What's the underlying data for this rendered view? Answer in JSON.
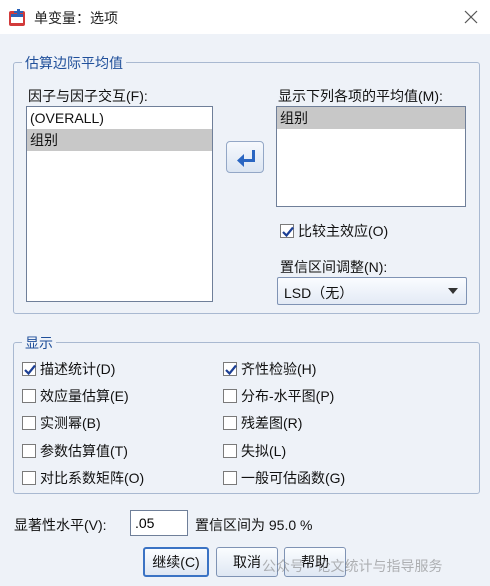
{
  "window": {
    "title": "单变量：选项"
  },
  "estimated_marginal_means": {
    "legend": "估算边际平均值",
    "factors_label": "因子与因子交互(F):",
    "factors": [
      {
        "label": "(OVERALL)",
        "selected": false
      },
      {
        "label": "组别",
        "selected": true
      }
    ],
    "display_means_label": "显示下列各项的平均值(M):",
    "display_means": [
      {
        "label": "组别",
        "selected": true
      }
    ],
    "compare_main_effects": {
      "label": "比较主效应(O)",
      "checked": true
    },
    "ci_adjustment_label": "置信区间调整(N):",
    "ci_adjustment_value": "LSD（无）"
  },
  "display": {
    "legend": "显示",
    "options": [
      {
        "label": "描述统计(D)",
        "checked": true
      },
      {
        "label": "齐性检验(H)",
        "checked": true
      },
      {
        "label": "效应量估算(E)",
        "checked": false
      },
      {
        "label": "分布-水平图(P)",
        "checked": false
      },
      {
        "label": "实测幂(B)",
        "checked": false
      },
      {
        "label": "残差图(R)",
        "checked": false
      },
      {
        "label": "参数估算值(T)",
        "checked": false
      },
      {
        "label": "失拟(L)",
        "checked": false
      },
      {
        "label": "对比系数矩阵(O)",
        "checked": false
      },
      {
        "label": "一般可估函数(G)",
        "checked": false
      }
    ]
  },
  "significance": {
    "label": "显著性水平(V):",
    "value": ".05",
    "ci_text": "置信区间为 95.0 %"
  },
  "buttons": {
    "continue": "继续(C)",
    "cancel": "取消",
    "help": "帮助"
  },
  "watermark": "公众号 · 论文统计与指导服务",
  "colors": {
    "accent": "#1f4f9a",
    "arrow": "#2a66c2",
    "check": "#1c3f94"
  }
}
